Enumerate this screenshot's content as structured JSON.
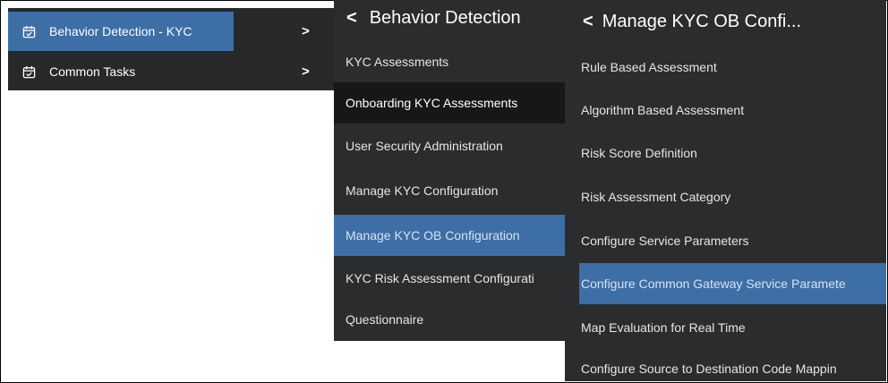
{
  "menu1": {
    "items": [
      {
        "label": "Behavior Detection - KYC",
        "icon": "calendar-check-icon",
        "active": true
      },
      {
        "label": "Common Tasks",
        "icon": "calendar-check-icon",
        "active": false
      }
    ]
  },
  "menu2": {
    "title": "Behavior Detection",
    "items": [
      {
        "label": "KYC Assessments"
      },
      {
        "label": "Onboarding KYC Assessments"
      },
      {
        "label": "User Security Administration"
      },
      {
        "label": "Manage KYC Configuration"
      },
      {
        "label": "Manage KYC OB Configuration"
      },
      {
        "label": "KYC Risk Assessment Configurati"
      },
      {
        "label": "Questionnaire"
      }
    ]
  },
  "menu3": {
    "title": "Manage KYC OB Confi...",
    "items": [
      {
        "label": "Rule Based Assessment"
      },
      {
        "label": "Algorithm Based Assessment"
      },
      {
        "label": "Risk Score Definition"
      },
      {
        "label": "Risk Assessment Category"
      },
      {
        "label": "Configure Service Parameters"
      },
      {
        "label": "Configure Common Gateway Service Paramete"
      },
      {
        "label": "Map Evaluation for Real Time"
      },
      {
        "label": "Configure Source to Destination Code Mappin"
      }
    ]
  },
  "colors": {
    "highlight": "#3d6ea6",
    "panel_bg": "#2a2c2e",
    "hover_row": "#161718"
  }
}
